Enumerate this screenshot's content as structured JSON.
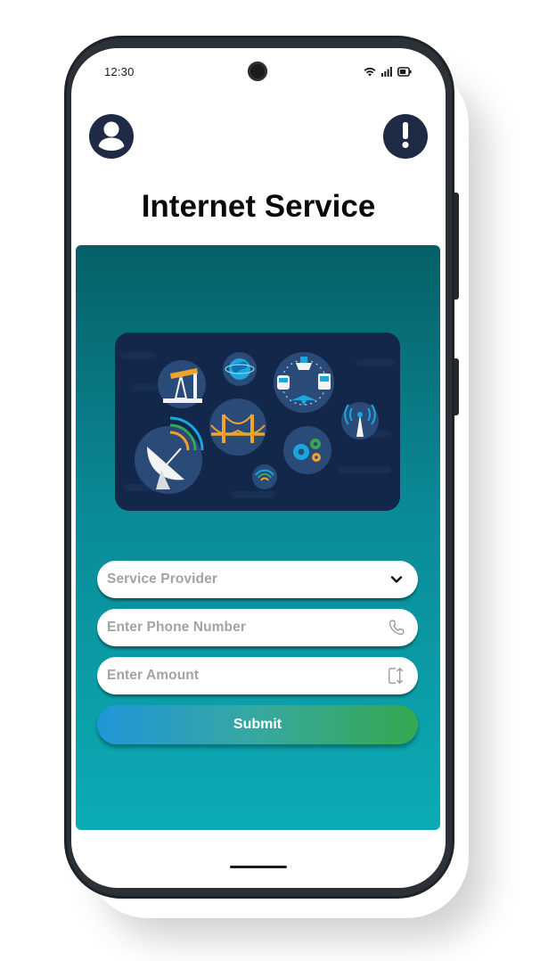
{
  "status_bar": {
    "time": "12:30",
    "icons": [
      "wifi-icon",
      "signal-icon",
      "battery-icon"
    ]
  },
  "header": {
    "left_icon": "profile-icon",
    "right_icon": "alert-icon",
    "title": "Internet Service"
  },
  "hero": {
    "illustration": "network-infrastructure-illustration",
    "elements": [
      "oil-pump-icon",
      "globe-icon",
      "transport-network-icon",
      "bridge-icon",
      "cell-tower-icon",
      "satellite-dish-icon",
      "gears-icon",
      "wifi-signal-icon"
    ]
  },
  "form": {
    "provider_placeholder": "Service Provider",
    "phone_placeholder": "Enter Phone Number",
    "amount_placeholder": "Enter Amount",
    "submit_label": "Submit"
  },
  "colors": {
    "panel_top": "#066068",
    "panel_bottom": "#0cacb5",
    "icon_bg": "#1f2a44",
    "submit_start": "#2196d8",
    "submit_end": "#35a850",
    "hero_bg": "#13274a"
  }
}
